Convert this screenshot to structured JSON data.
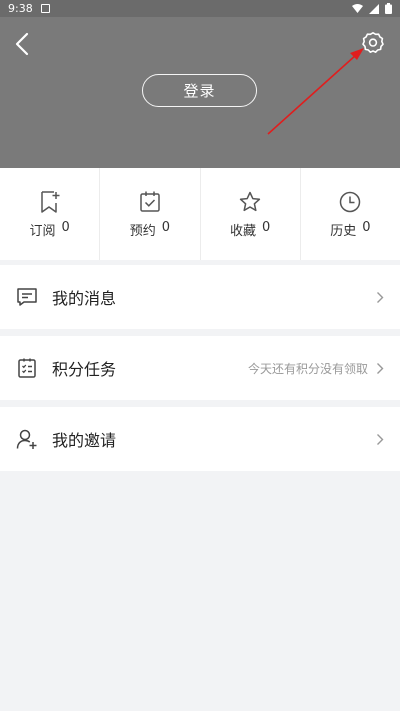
{
  "status_bar": {
    "time": "9:38"
  },
  "header": {
    "login_label": "登录"
  },
  "stats": [
    {
      "label": "订阅",
      "count": "0",
      "icon": "bookmark-add-icon"
    },
    {
      "label": "预约",
      "count": "0",
      "icon": "calendar-check-icon"
    },
    {
      "label": "收藏",
      "count": "0",
      "icon": "star-icon"
    },
    {
      "label": "历史",
      "count": "0",
      "icon": "clock-icon"
    }
  ],
  "menu": {
    "messages": {
      "label": "我的消息",
      "icon": "message-icon"
    },
    "points": {
      "label": "积分任务",
      "hint": "今天还有积分没有领取",
      "icon": "task-list-icon"
    },
    "invites": {
      "label": "我的邀请",
      "icon": "user-add-icon"
    }
  },
  "colors": {
    "header_bg": "#7a7a7a",
    "annotation_arrow": "#e11d1d",
    "page_bg": "#f2f3f5"
  }
}
